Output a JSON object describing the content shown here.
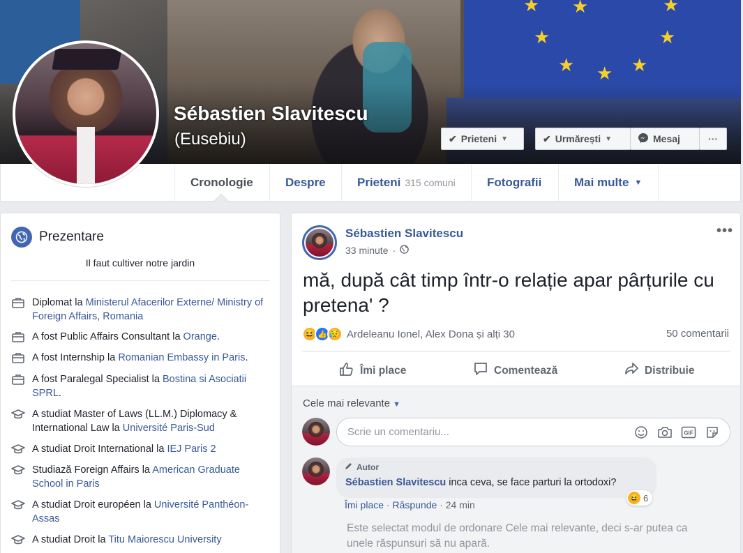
{
  "profile": {
    "name": "Sébastien Slavitescu",
    "alt_name": "(Eusebiu)",
    "buttons": {
      "friends": "Prieteni",
      "follow": "Urmărești",
      "message": "Mesaj",
      "more": "···"
    }
  },
  "nav": {
    "tabs": [
      {
        "label": "Cronologie"
      },
      {
        "label": "Despre"
      },
      {
        "label": "Prieteni",
        "sub": "315 comuni"
      },
      {
        "label": "Fotografii"
      },
      {
        "label": "Mai multe"
      }
    ]
  },
  "intro": {
    "title": "Prezentare",
    "bio": "Il faut cultiver notre jardin",
    "items": [
      {
        "icon": "briefcase-icon",
        "text": "Diplomat la ",
        "link": "Ministerul Afacerilor Externe/ Ministry of Foreign Affairs, Romania",
        "suffix": ""
      },
      {
        "icon": "briefcase-icon",
        "text": "A fost Public Affairs Consultant la ",
        "link": "Orange",
        "suffix": "."
      },
      {
        "icon": "briefcase-icon",
        "text": "A fost Internship la ",
        "link": "Romanian Embassy in Paris",
        "suffix": "."
      },
      {
        "icon": "briefcase-icon",
        "text": "A fost Paralegal Specialist la ",
        "link": "Bostina si Asociatii SPRL",
        "suffix": "."
      },
      {
        "icon": "graduation-cap-icon",
        "text": "A studiat Master of Laws (LL.M.) Diplomacy & International Law la ",
        "link": "Université Paris-Sud",
        "suffix": ""
      },
      {
        "icon": "graduation-cap-icon",
        "text": "A studiat Droit International la ",
        "link": "IEJ Paris 2",
        "suffix": ""
      },
      {
        "icon": "graduation-cap-icon",
        "text": "Studiază Foreign Affairs la ",
        "link": "American Graduate School in Paris",
        "suffix": ""
      },
      {
        "icon": "graduation-cap-icon",
        "text": "A studiat Droit européen la ",
        "link": "Université Panthéon-Assas",
        "suffix": ""
      },
      {
        "icon": "graduation-cap-icon",
        "text": "A studiat Droit la ",
        "link": "Titu Maiorescu University",
        "suffix": ""
      }
    ]
  },
  "post": {
    "author": "Sébastien Slavitescu",
    "time": "33 minute",
    "text": "mă, după cât timp într-o relație apar pârțurile cu pretena' ?",
    "reactions_text": "Ardeleanu Ionel, Alex Dona și alți 30",
    "comments_count": "50 comentarii",
    "actions": {
      "like": "Îmi place",
      "comment": "Comentează",
      "share": "Distribuie"
    },
    "sort_label": "Cele mai relevante",
    "comment_placeholder": "Scrie un comentariu...",
    "comment": {
      "author_tag": "Autor",
      "author": "Sébastien Slavitescu",
      "text": "inca ceva, se face parturi la ortodoxi?",
      "reaction_count": "6",
      "like": "Îmi place",
      "reply": "Răspunde",
      "time": "24 min"
    },
    "sort_note": "Este selectat modul de ordonare Cele mai relevante, deci s-ar putea ca unele răspunsuri să nu apară."
  }
}
